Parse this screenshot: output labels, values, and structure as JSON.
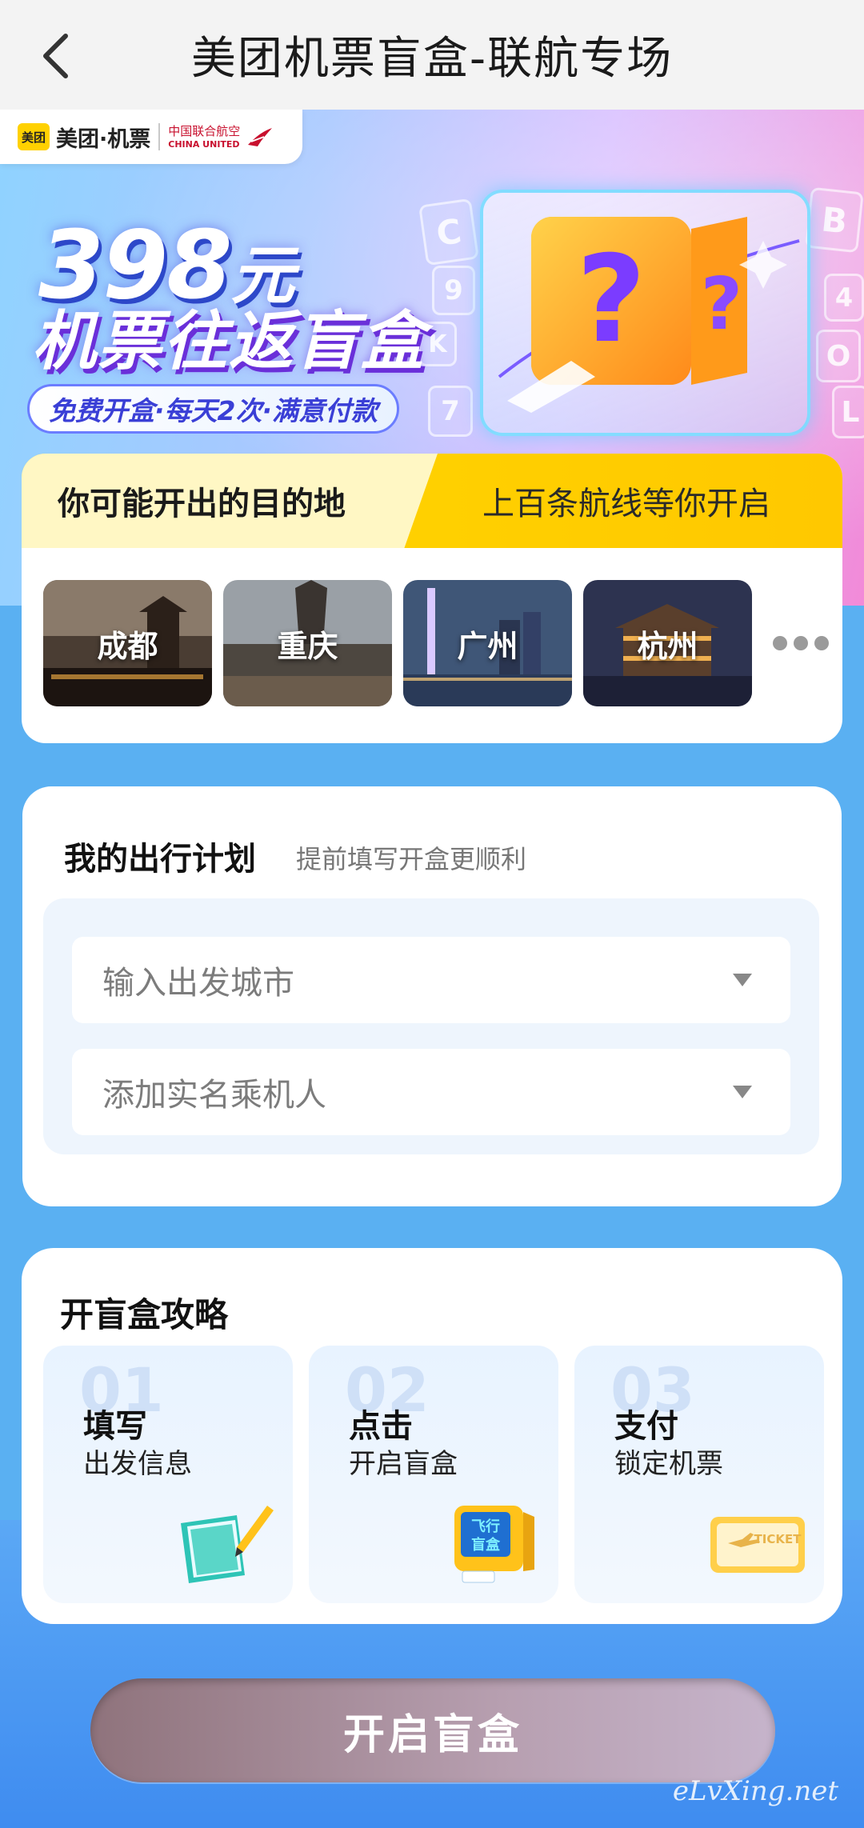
{
  "nav": {
    "title": "美团机票盲盒-联航专场",
    "back_icon": "chevron-left-icon"
  },
  "brand": {
    "meituan_logo": "美团",
    "meituan_text": "美团·机票",
    "china_united_cn": "中国联合航空",
    "china_united_en": "CHINA UNITED"
  },
  "hero": {
    "price": "398",
    "price_unit": "元",
    "headline": "机票往返盲盒",
    "pill": "免费开盒·每天2次·满意付款",
    "deco_letters": [
      "C",
      "9",
      "K",
      "7",
      "B",
      "4",
      "O",
      "L"
    ]
  },
  "destinations": {
    "title": "你可能开出的目的地",
    "subtitle": "上百条航线等你开启",
    "cities": [
      "成都",
      "重庆",
      "广州",
      "杭州"
    ]
  },
  "plan": {
    "title": "我的出行计划",
    "subtitle": "提前填写开盒更顺利",
    "departure_placeholder": "输入出发城市",
    "passenger_placeholder": "添加实名乘机人"
  },
  "strategy": {
    "title": "开盲盒攻略",
    "steps": [
      {
        "num": "01",
        "head": "填写",
        "text": "出发信息",
        "icon": "notebook-icon"
      },
      {
        "num": "02",
        "head": "点击",
        "text": "开启盲盒",
        "icon": "blind-box-icon",
        "icon_text": "飞行\n盲盒"
      },
      {
        "num": "03",
        "head": "支付",
        "text": "锁定机票",
        "icon": "ticket-icon",
        "icon_text": "TICKET"
      }
    ]
  },
  "cta": {
    "label": "开启盲盒"
  },
  "watermark": "eLvXing.net",
  "colors": {
    "accent_yellow": "#ffd800",
    "page_blue": "#5ab0f2",
    "brand_red": "#c8102e"
  }
}
